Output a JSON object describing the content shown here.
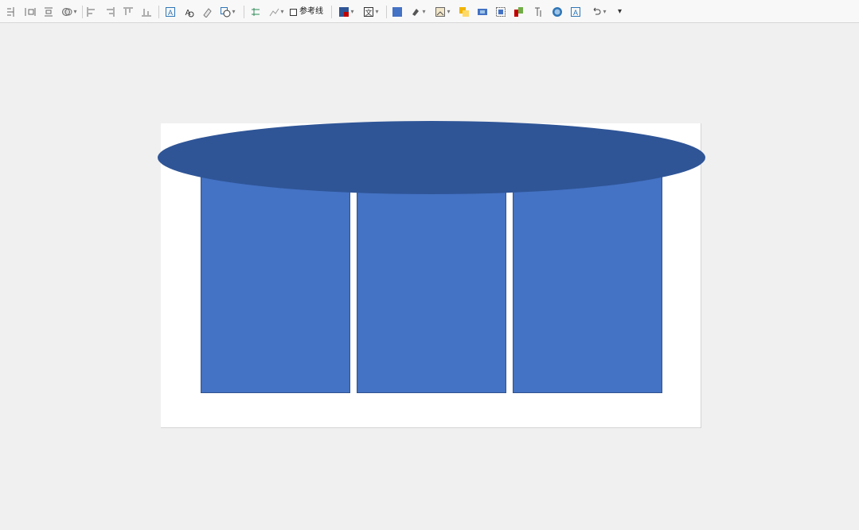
{
  "toolbar": {
    "groups": [
      [
        "align-distribute-icon",
        "align-center-h-icon",
        "align-middle-icon",
        "group-icon"
      ],
      [
        "align-left-icon",
        "align-right-icon",
        "align-top-icon",
        "align-bottom-icon"
      ],
      [
        "text-box-icon",
        "text-wrap-icon",
        "rotate-icon",
        "select-shape-icon"
      ],
      [
        "connector-icon",
        "edit-points-icon"
      ],
      [
        "fill-color-icon",
        "text-style-icon"
      ],
      [
        "shape-fill-icon",
        "outline-icon",
        "shape-effects-icon",
        "bring-forward-icon",
        "send-backward-icon",
        "selection-pane-icon",
        "wordart-icon",
        "text-direction-icon",
        "shape-style-icon",
        "text-box-insert-icon",
        "undo-icon",
        "more-icon"
      ]
    ],
    "reference_line_label": "参考线"
  },
  "colors": {
    "ellipse": "#2f5597",
    "column": "#4472c4",
    "column_border": "#2f528f",
    "canvas": "#ffffff",
    "background": "#f0f0f0"
  }
}
